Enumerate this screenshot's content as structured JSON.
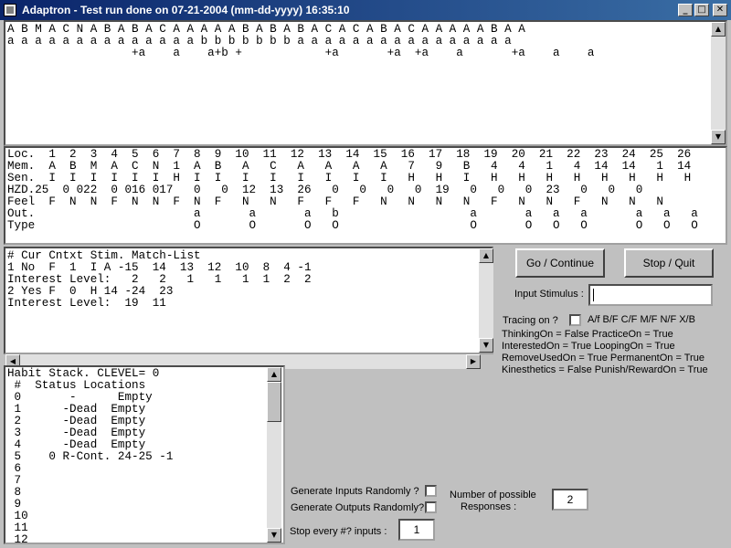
{
  "window": {
    "title": "Adaptron  -  Test run done on 07-21-2004 (mm-dd-yyyy) 16:35:10",
    "minimize": "_",
    "maximize": "□",
    "close": "✕"
  },
  "panels": {
    "sequence": "A B M A C N A B A B A C A A A A A B A B A B A C A C A B A C A A A A A B A A\na a a a a a a a a a a a a a b b b b b b b a a a a a a a a a a a a a a a a\n                  +a    a    a+b +            +a       +a  +a    a       +a    a    a",
    "memory": "Loc.  1  2  3  4  5  6  7  8  9  10  11  12  13  14  15  16  17  18  19  20  21  22  23  24  25  26\nMem.  A  B  M  A  C  N  1  A  B   A   C   A   A   A   A   7   9   B   4   4   1   4  14  14   1  14\nSen.  I  I  I  I  I  I  H  I  I   I   I   I   I   I   I   H   H   I   H   H   H   H   H   H   H   H\nHZD.25  0 022  0 016 017   0   0  12  13  26   0   0   0   0  19   0   0   0  23   0   0   0\nFeel  F  N  N  F  N  N  F  N  F   N   N   F   F   F   N   N   N   N   F   N   N   F   N   N   N\nOut.                       a       a       a   b                   a       a   a   a       a   a   a\nType                       O       O       O   O                   O       O   O   O       O   O   O",
    "stimulus": "# Cur Cntxt Stim. Match-List\n1 No  F  1  I A -15  14  13  12  10  8  4 -1\nInterest Level:   2   2   1   1   1  1  2  2\n2 Yes F  0  H 14 -24  23\nInterest Level:  19  11",
    "habit": "Habit Stack. CLEVEL= 0\n #  Status Locations\n 0       -      Empty\n 1      -Dead  Empty\n 2      -Dead  Empty\n 3      -Dead  Empty\n 4      -Dead  Empty\n 5    0 R-Cont. 24-25 -1\n 6\n 7\n 8\n 9\n 10\n 11\n 12"
  },
  "controls": {
    "go_label": "Go / Continue",
    "stop_label": "Stop / Quit",
    "input_stimulus_label": "Input Stimulus :",
    "input_stimulus_value": "",
    "tracing_label": "Tracing on ?",
    "tracing_options": "A/f  B/F  C/F  M/F  N/F  X/B",
    "flags": [
      "ThinkingOn = False PracticeOn = True",
      "InterestedOn = True LoopingOn = True",
      "RemoveUsedOn = True PermanentOn = True",
      "Kinesthetics = False Punish/RewardOn = True"
    ],
    "gen_inputs_label": "Generate Inputs Randomly ?",
    "gen_outputs_label": "Generate Outputs Randomly?",
    "num_responses_label_1": "Number of possible",
    "num_responses_label_2": "Responses :",
    "num_responses_value": "2",
    "stop_every_label": "Stop every #? inputs :",
    "stop_every_value": "1"
  },
  "colors": {
    "titlebar_start": "#0a246a",
    "titlebar_end": "#3a6ea5",
    "face": "#c0c0c0"
  }
}
